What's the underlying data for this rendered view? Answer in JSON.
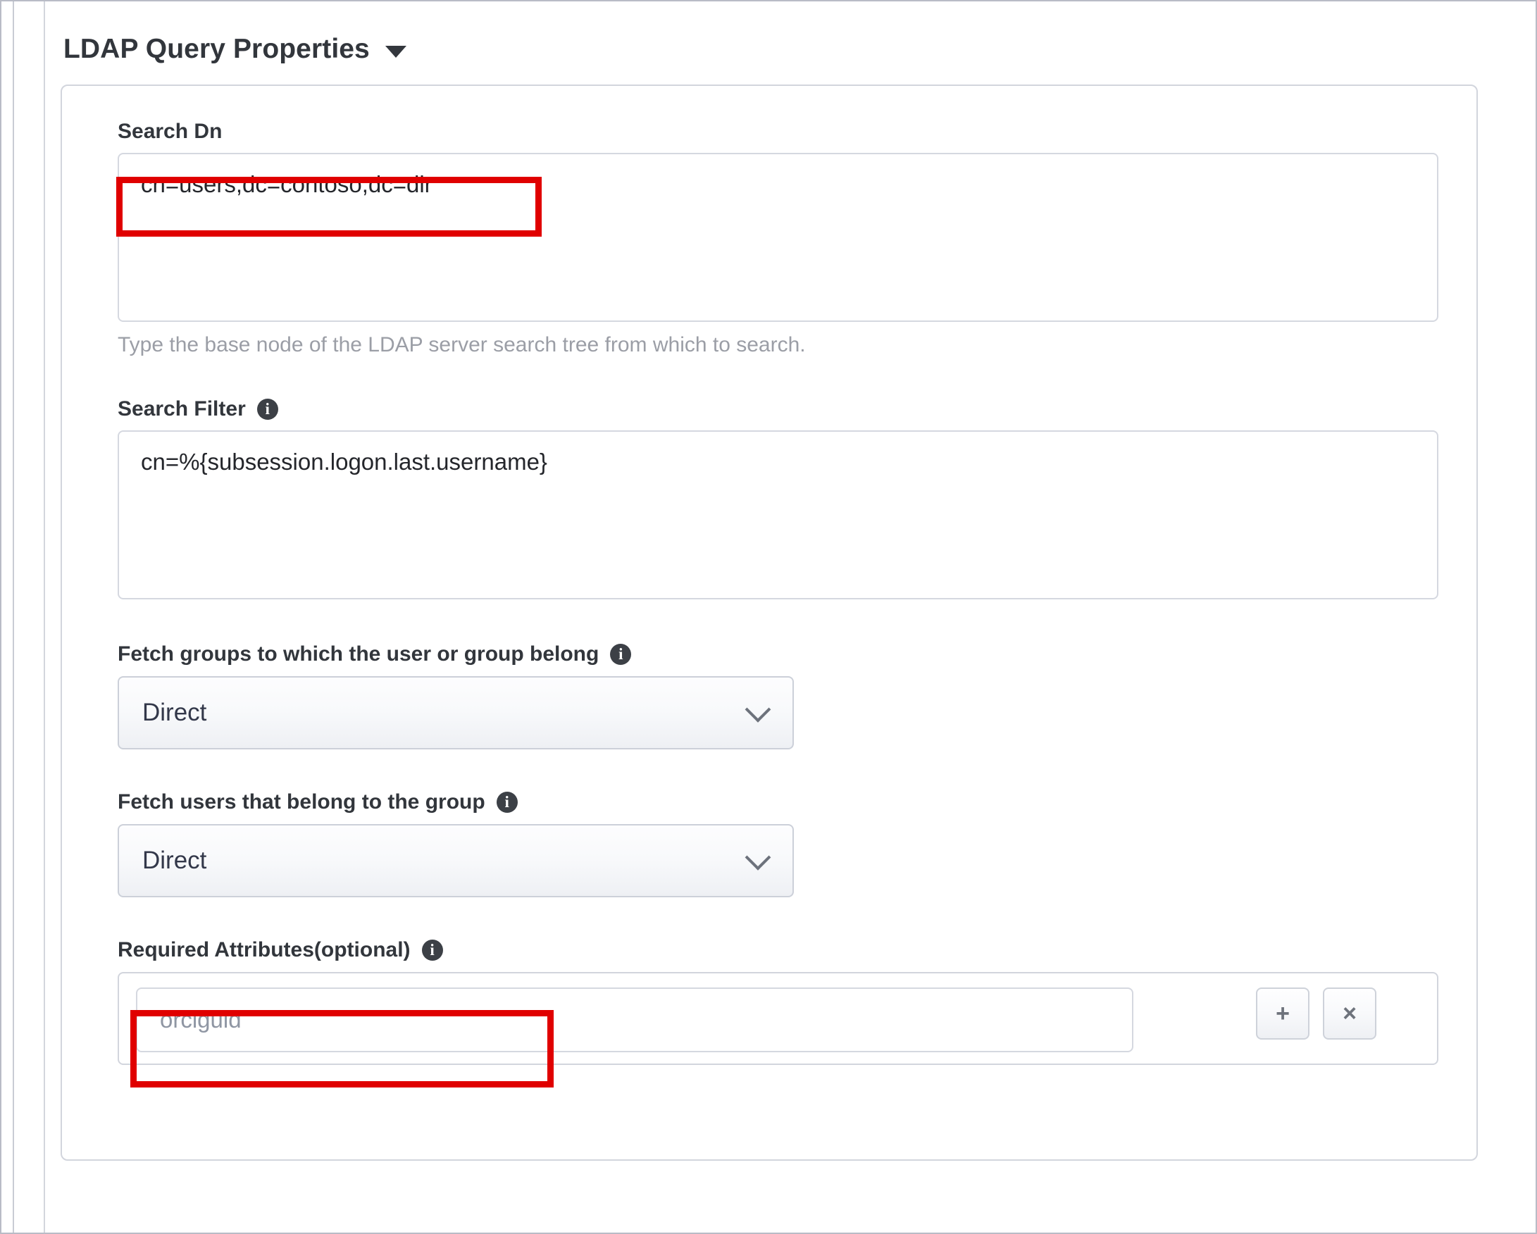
{
  "section": {
    "title": "LDAP Query Properties",
    "caret_icon": "chevron-down-icon"
  },
  "fields": {
    "search_dn": {
      "label": "Search Dn",
      "value": "cn=users,dc=contoso,dc=dir",
      "help": "Type the base node of the LDAP server search tree from which to search."
    },
    "search_filter": {
      "label": "Search Filter",
      "value": "cn=%{subsession.logon.last.username}",
      "info_icon": "info-icon"
    },
    "fetch_groups": {
      "label": "Fetch groups to which the user or group belong",
      "value": "Direct",
      "info_icon": "info-icon",
      "chevron_icon": "chevron-down-icon"
    },
    "fetch_users": {
      "label": "Fetch users that belong to the group",
      "value": "Direct",
      "info_icon": "info-icon",
      "chevron_icon": "chevron-down-icon"
    },
    "required_attributes": {
      "label": "Required Attributes(optional)",
      "value": "orclguid",
      "info_icon": "info-icon",
      "add_label": "+",
      "remove_label": "×"
    }
  },
  "annotations": {
    "highlight_color": "#e00000",
    "boxes": [
      {
        "name": "search-dn-highlight"
      },
      {
        "name": "required-attributes-highlight"
      }
    ]
  }
}
